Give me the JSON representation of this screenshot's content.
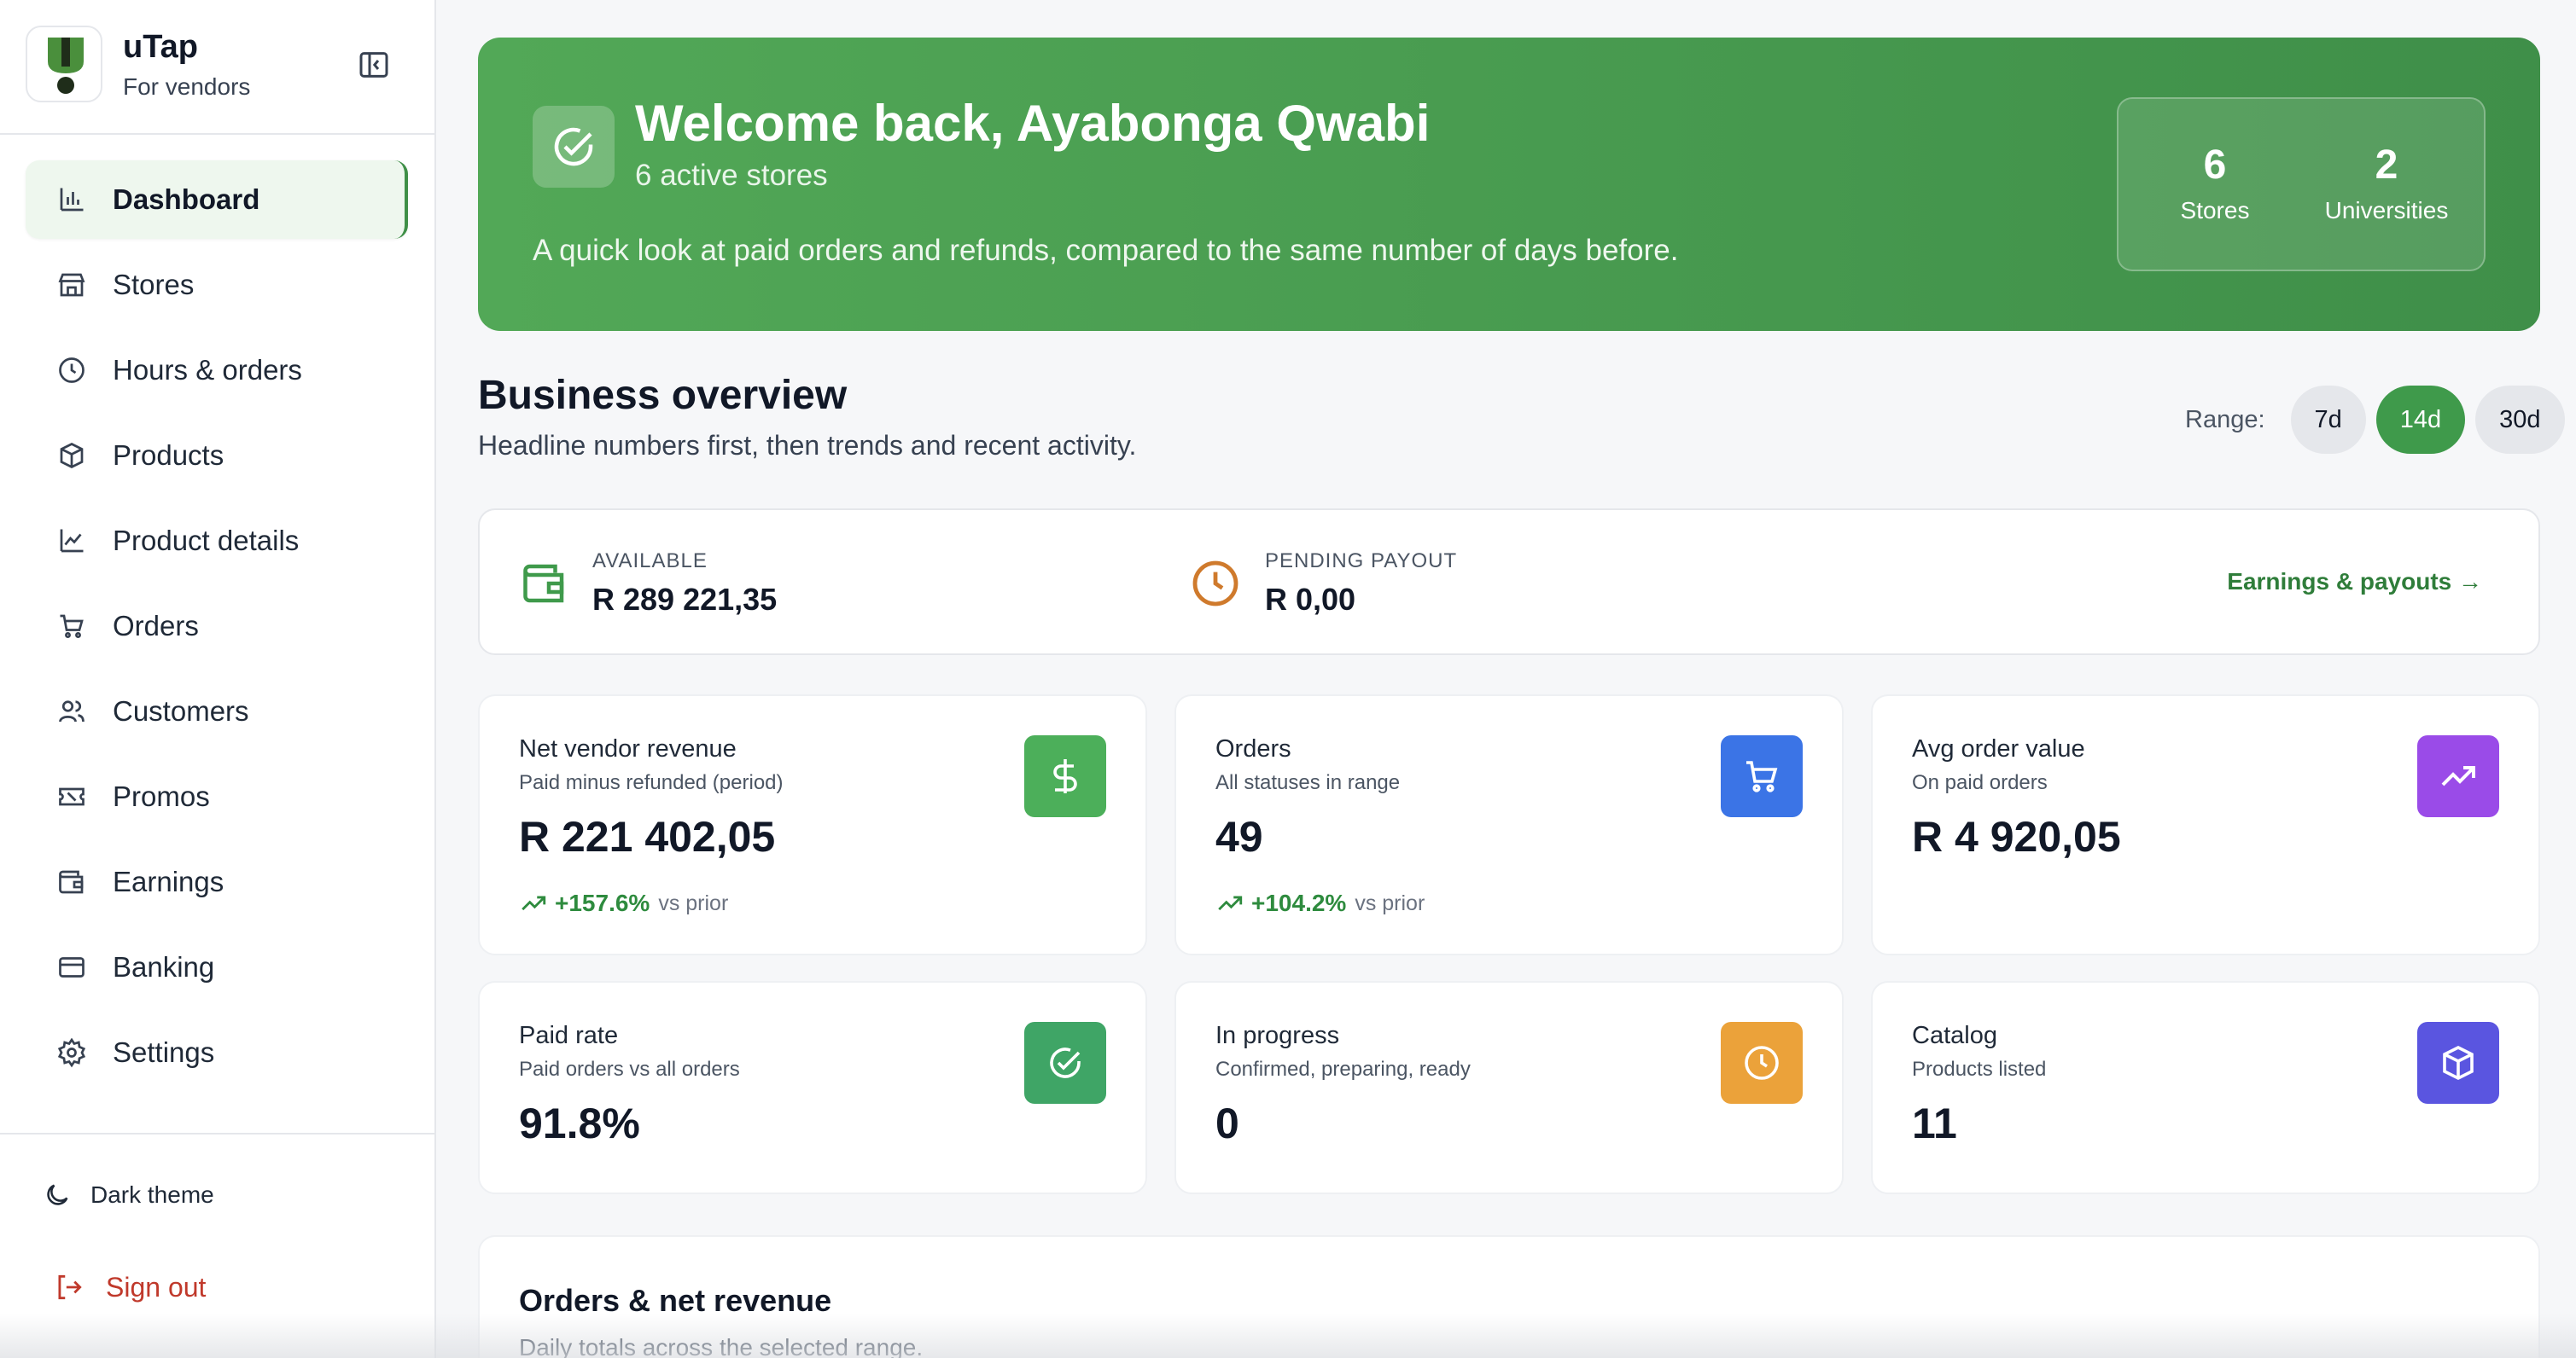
{
  "brand": {
    "title": "uTap",
    "subtitle": "For vendors"
  },
  "sidebar": {
    "items": [
      {
        "label": "Dashboard",
        "icon": "bar-chart-icon",
        "active": true
      },
      {
        "label": "Stores",
        "icon": "store-icon"
      },
      {
        "label": "Hours & orders",
        "icon": "clock-icon"
      },
      {
        "label": "Products",
        "icon": "box-icon"
      },
      {
        "label": "Product details",
        "icon": "line-chart-icon"
      },
      {
        "label": "Orders",
        "icon": "cart-icon"
      },
      {
        "label": "Customers",
        "icon": "users-icon"
      },
      {
        "label": "Promos",
        "icon": "ticket-icon"
      },
      {
        "label": "Earnings",
        "icon": "wallet-icon"
      },
      {
        "label": "Banking",
        "icon": "credit-card-icon"
      },
      {
        "label": "Settings",
        "icon": "gear-icon"
      }
    ],
    "theme_label": "Dark theme",
    "signout_label": "Sign out"
  },
  "hero": {
    "title": "Welcome back, Ayabonga Qwabi",
    "subtitle": "6 active stores",
    "description": "A quick look at paid orders and refunds, compared to the same number of days before.",
    "stats": [
      {
        "value": "6",
        "label": "Stores"
      },
      {
        "value": "2",
        "label": "Universities"
      }
    ]
  },
  "overview": {
    "title": "Business overview",
    "subtitle": "Headline numbers first, then trends and recent activity."
  },
  "range": {
    "label": "Range:",
    "options": [
      "7d",
      "14d",
      "30d"
    ],
    "selected": "14d"
  },
  "balance": {
    "available_label": "AVAILABLE",
    "available_value": "R 289 221,35",
    "pending_label": "PENDING PAYOUT",
    "pending_value": "R 0,00",
    "link": "Earnings & payouts →"
  },
  "cards": [
    {
      "title": "Net vendor revenue",
      "sub": "Paid minus refunded (period)",
      "value": "R 221 402,05",
      "trend": "+157.6%",
      "vs": "vs prior",
      "icon": "dollar-icon",
      "color": "#4caf5a"
    },
    {
      "title": "Orders",
      "sub": "All statuses in range",
      "value": "49",
      "trend": "+104.2%",
      "vs": "vs prior",
      "icon": "cart-icon",
      "color": "#3b74e6"
    },
    {
      "title": "Avg order value",
      "sub": "On paid orders",
      "value": "R 4 920,05",
      "icon": "trending-up-icon",
      "color": "#9a4be8"
    },
    {
      "title": "Paid rate",
      "sub": "Paid orders vs all orders",
      "value": "91.8%",
      "icon": "check-circle-icon",
      "color": "#3fa566"
    },
    {
      "title": "In progress",
      "sub": "Confirmed, preparing, ready",
      "value": "0",
      "icon": "clock-icon",
      "color": "#eba23a"
    },
    {
      "title": "Catalog",
      "sub": "Products listed",
      "value": "11",
      "icon": "box-icon",
      "color": "#5a55e0"
    }
  ],
  "chart_section": {
    "title": "Orders & net revenue",
    "subtitle": "Daily totals across the selected range."
  }
}
